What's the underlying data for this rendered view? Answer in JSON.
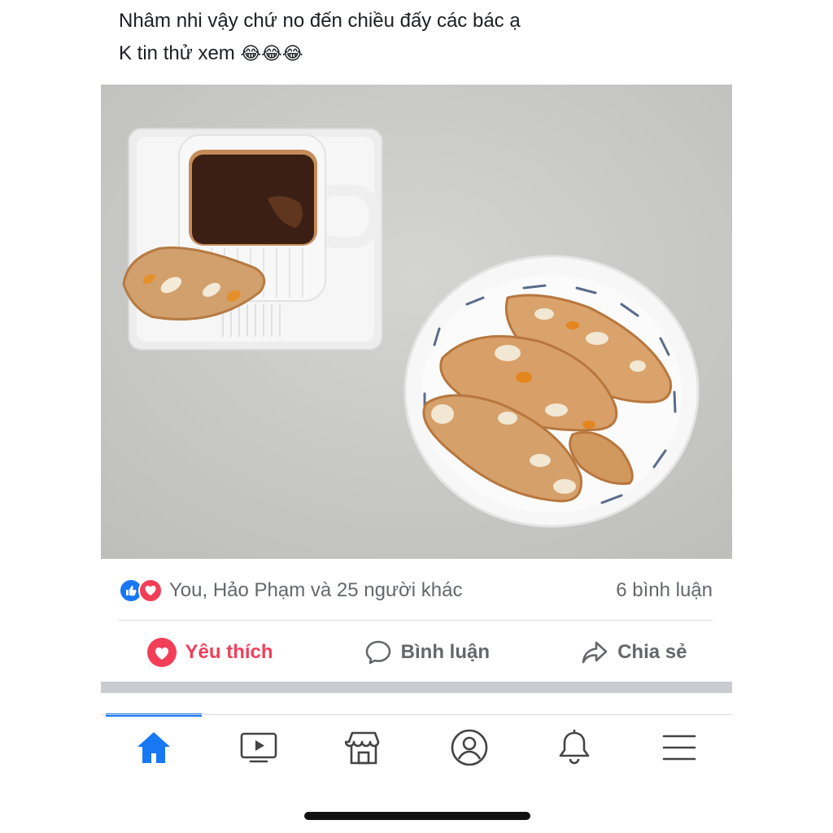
{
  "post": {
    "caption_line1": "Nhâm nhi vậy chứ no đến chiều đấy các bác ạ",
    "caption_line2": "K tin thử xem",
    "caption_emoji": "😂😂😂"
  },
  "reactions": {
    "summary": "You, Hảo Phạm và 25 người khác",
    "comments_count": "6 bình luận",
    "icons": [
      "like-icon",
      "love-icon"
    ]
  },
  "actions": {
    "like_label": "Yêu thích",
    "comment_label": "Bình luận",
    "share_label": "Chia sẻ"
  },
  "tabs": [
    "home-icon",
    "video-icon",
    "marketplace-icon",
    "profile-icon",
    "notifications-icon",
    "menu-icon"
  ],
  "colors": {
    "accent": "#1877f2",
    "love": "#f33e58",
    "text_secondary": "#65676b"
  }
}
